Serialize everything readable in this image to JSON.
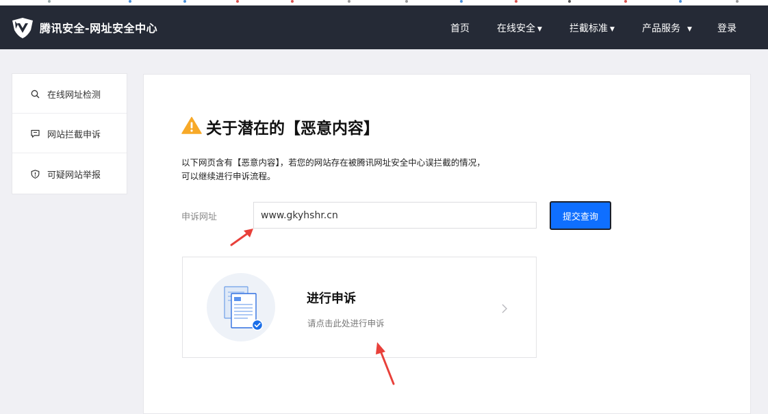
{
  "header": {
    "brand": "腾讯安全-网址安全中心",
    "nav": [
      {
        "label": "首页",
        "dropdown": false
      },
      {
        "label": "在线安全",
        "dropdown": true
      },
      {
        "label": "拦截标准",
        "dropdown": true
      },
      {
        "label": "产品服务",
        "dropdown": true
      },
      {
        "label": "登录",
        "dropdown": false
      }
    ]
  },
  "sidebar": {
    "items": [
      {
        "label": "在线网址检测",
        "icon": "search-icon"
      },
      {
        "label": "网站拦截申诉",
        "icon": "message-icon"
      },
      {
        "label": "可疑网站举报",
        "icon": "shield-icon"
      }
    ]
  },
  "main": {
    "title": "关于潜在的【恶意内容】",
    "description_line1": "以下网页含有【恶意内容】，若您的网站存在被腾讯网址安全中心误拦截的情况，",
    "description_line2": "可以继续进行申诉流程。",
    "url_label": "申诉网址",
    "url_value": "www.gkyhshr.cn",
    "submit_label": "提交查询",
    "appeal_card": {
      "title": "进行申诉",
      "subtitle": "请点击此处进行申诉",
      "icon": "document-check-icon"
    }
  },
  "colors": {
    "navbar_bg": "#252a36",
    "accent_blue": "#0f6fff",
    "warning_orange": "#f7a928",
    "annotation_red": "#e8403a",
    "page_bg": "#f0f0f4"
  }
}
